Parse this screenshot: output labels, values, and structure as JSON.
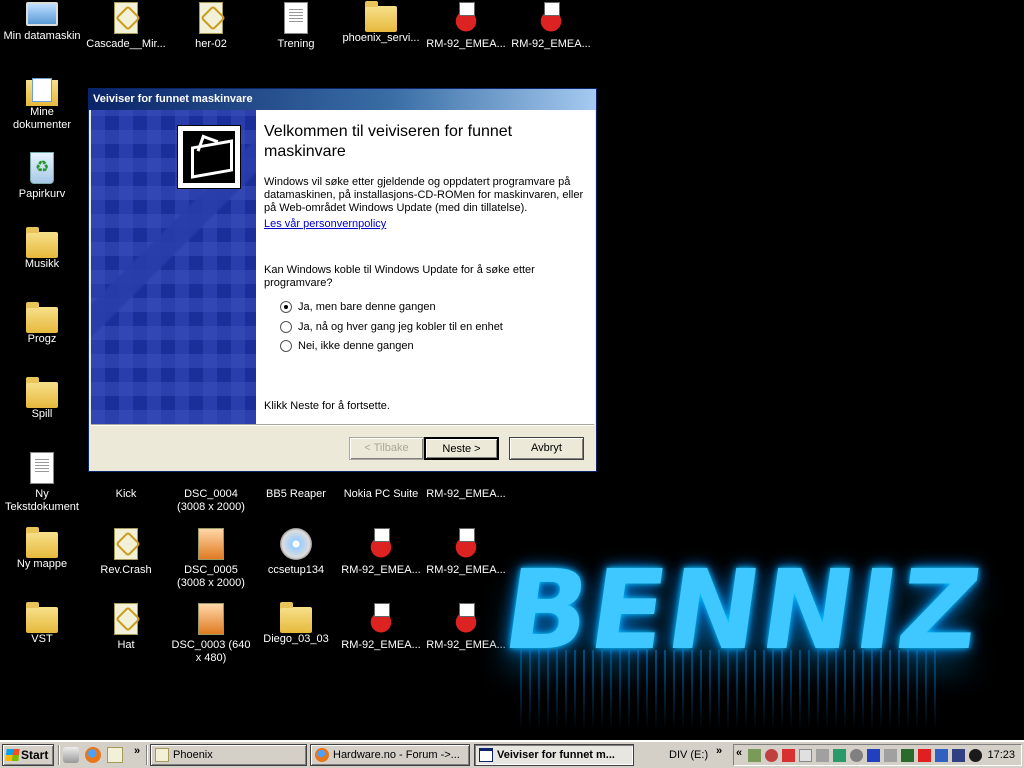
{
  "desktop": {
    "icons": [
      {
        "label": "Min datamaskin"
      },
      {
        "label": "Cascade__Mir..."
      },
      {
        "label": "her-02"
      },
      {
        "label": "Trening"
      },
      {
        "label": "phoenix_servi..."
      },
      {
        "label": "RM-92_EMEA..."
      },
      {
        "label": "RM-92_EMEA..."
      },
      {
        "label": "Mine dokumenter"
      },
      {
        "label": "Papirkurv"
      },
      {
        "label": "Musikk"
      },
      {
        "label": "Progz"
      },
      {
        "label": "Spill"
      },
      {
        "label": "Ny Tekstdokument"
      },
      {
        "label": "Kick"
      },
      {
        "label": "DSC_0004 (3008 x 2000)"
      },
      {
        "label": "BB5 Reaper"
      },
      {
        "label": "Nokia PC Suite"
      },
      {
        "label": "RM-92_EMEA..."
      },
      {
        "label": "Ny mappe"
      },
      {
        "label": "Rev.Crash"
      },
      {
        "label": "DSC_0005 (3008 x 2000)"
      },
      {
        "label": "ccsetup134"
      },
      {
        "label": "RM-92_EMEA..."
      },
      {
        "label": "RM-92_EMEA..."
      },
      {
        "label": "VST"
      },
      {
        "label": "Hat"
      },
      {
        "label": "DSC_0003 (640 x 480)"
      },
      {
        "label": "Diego_03_03"
      },
      {
        "label": "RM-92_EMEA..."
      },
      {
        "label": "RM-92_EMEA..."
      }
    ],
    "wallpaper_text": "BENNIZ",
    "wallpaper_color": "#3fc8ff"
  },
  "wizard": {
    "title": "Veiviser for funnet maskinvare",
    "heading": "Velkommen til veiviseren for funnet maskinvare",
    "description": "Windows vil søke etter gjeldende og oppdatert programvare på datamaskinen, på installasjons-CD-ROMen for maskinvaren, eller på Web-området Windows Update (med din tillatelse).",
    "privacy_link": "Les vår personvernpolicy",
    "question": "Kan Windows koble til Windows Update for å søke etter programvare?",
    "options": [
      {
        "label": "Ja, men bare denne gangen",
        "selected": true
      },
      {
        "label": "Ja, nå og hver gang jeg kobler til en enhet",
        "selected": false
      },
      {
        "label": "Nei, ikke denne gangen",
        "selected": false
      }
    ],
    "footer": "Klikk Neste for å fortsette.",
    "back_label": "< Tilbake",
    "next_label": "Neste >",
    "cancel_label": "Avbryt",
    "panel_color": "#1b2f9b"
  },
  "taskbar": {
    "start_label": "Start",
    "overflow": "»",
    "tasks": [
      {
        "label": "Phoenix"
      },
      {
        "label": "Hardware.no - Forum ->..."
      },
      {
        "label": "Veiviser for funnet m..."
      }
    ],
    "drive_label": "DIV (E:)",
    "tray_chevron": "«",
    "clock": "17:23"
  }
}
